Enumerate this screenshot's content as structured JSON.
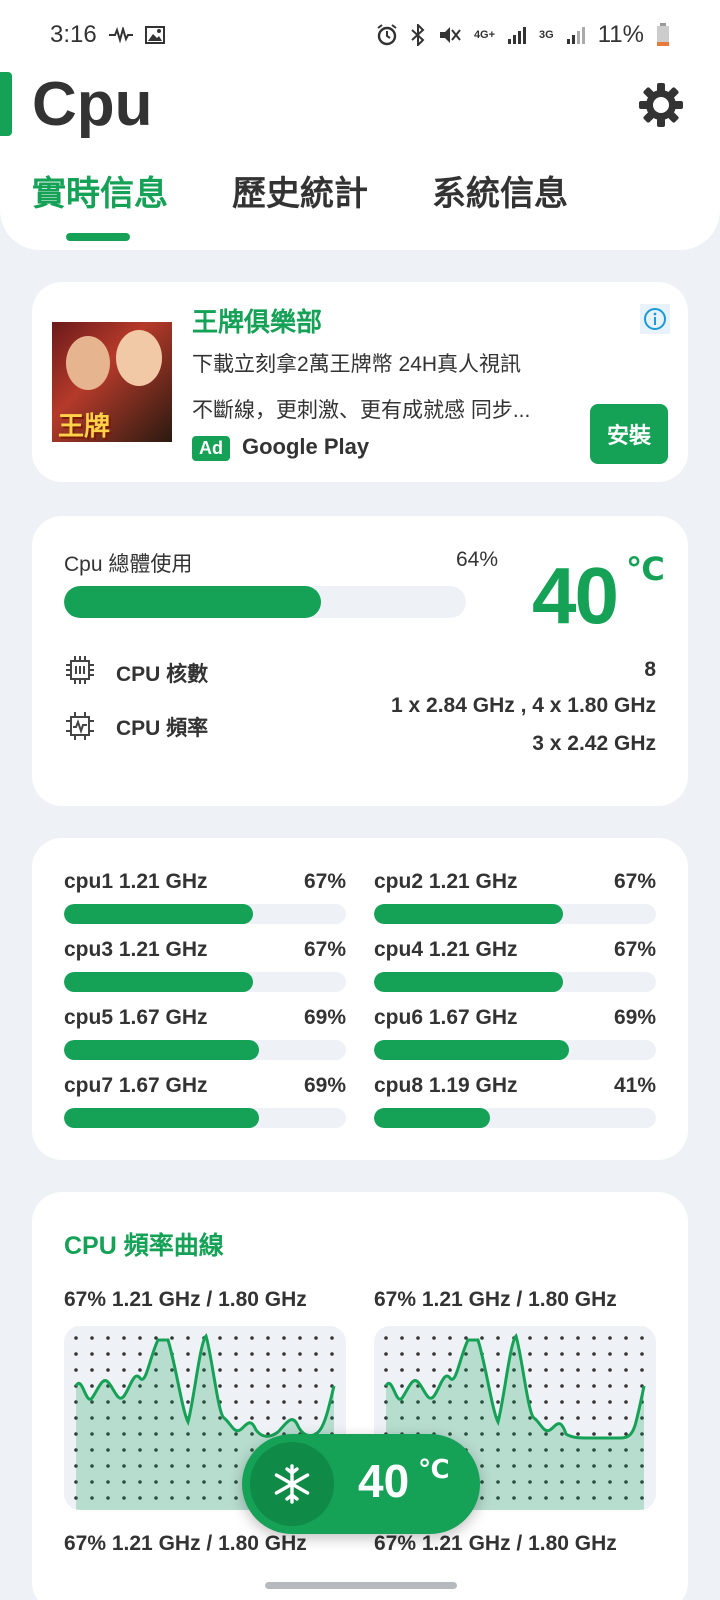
{
  "status_bar": {
    "time": "3:16",
    "network_4g": "4G+",
    "network_3g": "3G",
    "battery": "11%"
  },
  "header": {
    "title": "Cpu",
    "tabs": [
      {
        "label": "實時信息",
        "active": true
      },
      {
        "label": "歷史統計",
        "active": false
      },
      {
        "label": "系統信息",
        "active": false
      }
    ]
  },
  "ad": {
    "image_text": "王牌",
    "title": "王牌俱樂部",
    "line1": "下載立刻拿2萬王牌幣 24H真人視訊",
    "line2": "不斷線，更刺激、更有成就感 同步...",
    "tag": "Ad",
    "store": "Google Play",
    "install": "安裝"
  },
  "usage": {
    "label": "Cpu 總體使用",
    "percent_text": "64%",
    "percent": 64,
    "temperature": "40",
    "temp_unit": "℃",
    "cores_label": "CPU 核數",
    "cores_value": "8",
    "freq_label": "CPU 頻率",
    "freq_line1": "1 x 2.84 GHz , 4 x 1.80 GHz",
    "freq_line2": "3 x 2.42 GHz"
  },
  "cores": [
    {
      "name": "cpu1  1.21 GHz",
      "pct_text": "67%",
      "pct": 67
    },
    {
      "name": "cpu2  1.21 GHz",
      "pct_text": "67%",
      "pct": 67
    },
    {
      "name": "cpu3  1.21 GHz",
      "pct_text": "67%",
      "pct": 67
    },
    {
      "name": "cpu4  1.21 GHz",
      "pct_text": "67%",
      "pct": 67
    },
    {
      "name": "cpu5  1.67 GHz",
      "pct_text": "69%",
      "pct": 69
    },
    {
      "name": "cpu6  1.67 GHz",
      "pct_text": "69%",
      "pct": 69
    },
    {
      "name": "cpu7  1.67 GHz",
      "pct_text": "69%",
      "pct": 69
    },
    {
      "name": "cpu8  1.19 GHz",
      "pct_text": "41%",
      "pct": 41
    }
  ],
  "curves": {
    "title": "CPU 頻率曲線",
    "blocks": [
      {
        "head": "67%  1.21 GHz / 1.80 GHz",
        "foot": "67%  1.21 GHz / 1.80 GHz"
      },
      {
        "head": "67%  1.21 GHz / 1.80 GHz",
        "foot": "67%  1.21 GHz / 1.80 GHz"
      }
    ]
  },
  "floating": {
    "temperature": "40",
    "unit": "℃"
  },
  "colors": {
    "accent": "#15a156",
    "background": "#eef2f7"
  }
}
